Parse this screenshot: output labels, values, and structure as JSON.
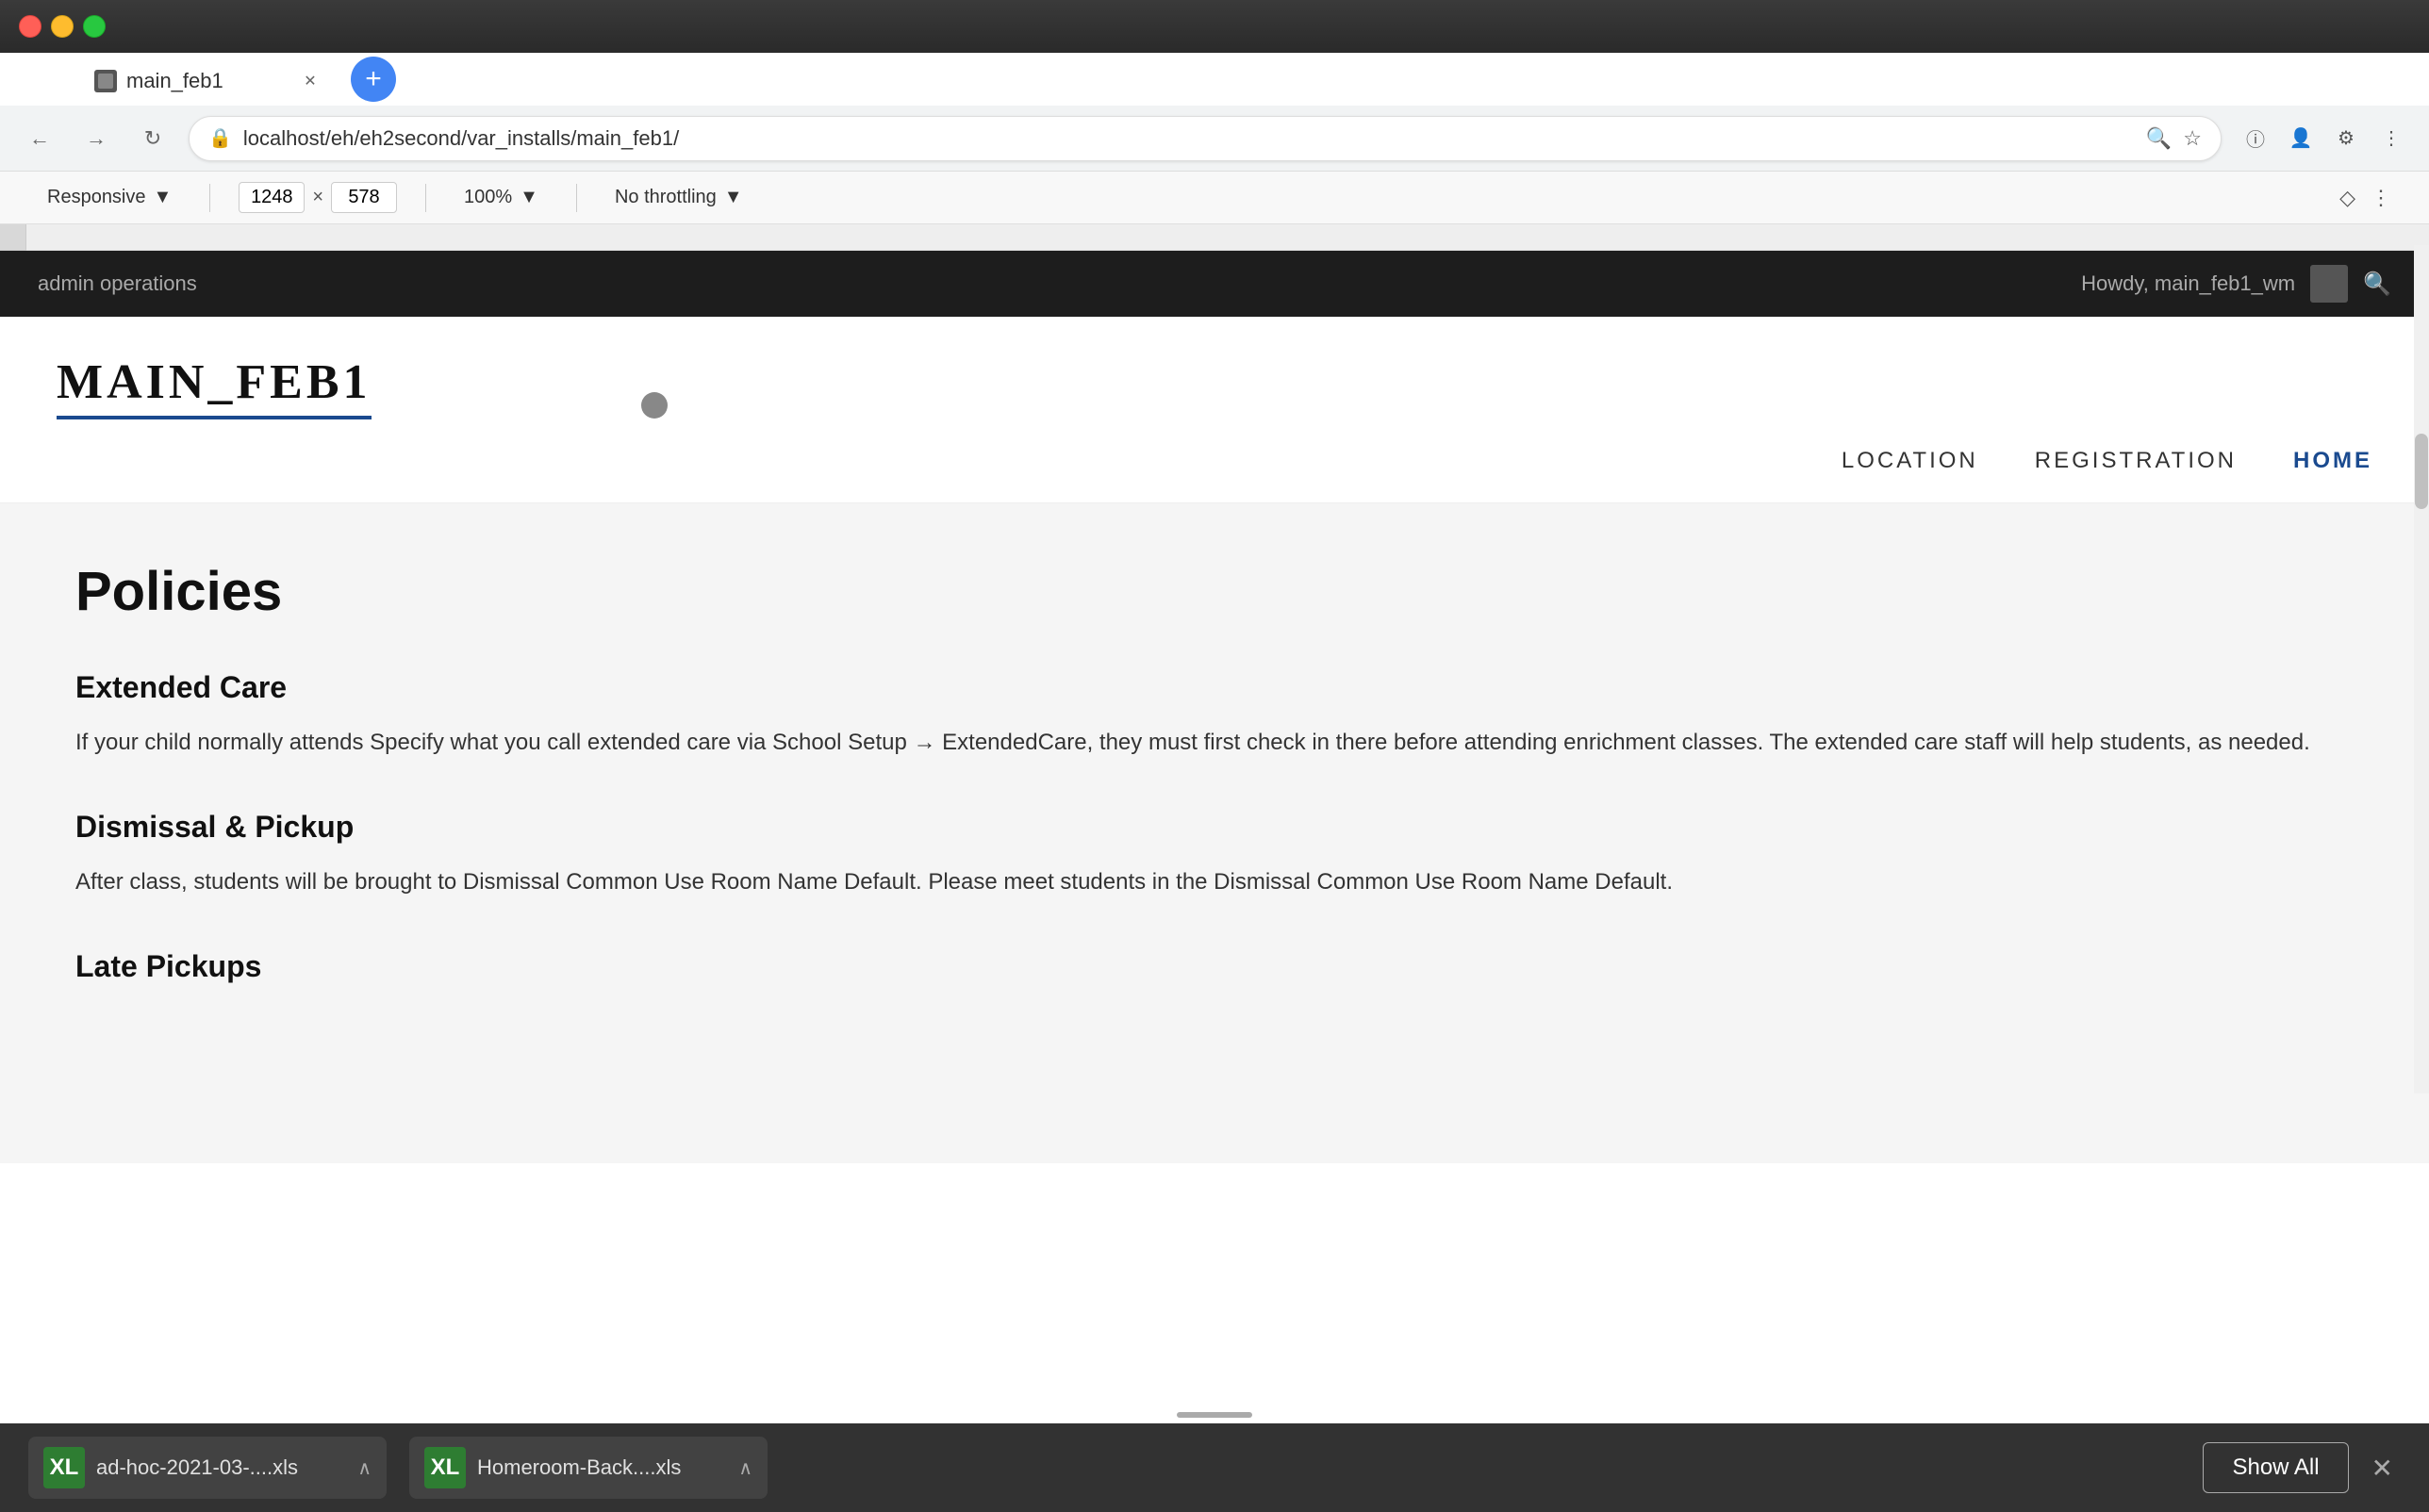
{
  "browser": {
    "traffic_lights": [
      "red",
      "yellow",
      "green"
    ],
    "tab": {
      "title": "main_feb1",
      "favicon_color": "#555"
    },
    "new_tab_label": "+",
    "address": {
      "url": "localhost/eh/eh2second/var_installs/main_feb1/",
      "lock_icon": "🔒"
    },
    "nav": {
      "back": "←",
      "forward": "→",
      "refresh": "↻"
    }
  },
  "devtools": {
    "viewport_mode": "Responsive",
    "width": "1248",
    "height": "578",
    "zoom": "100%",
    "throttling": "No throttling",
    "diamond_icon": "◇"
  },
  "admin_bar": {
    "title": "admin operations",
    "howdy": "Howdy, main_feb1_wm"
  },
  "site": {
    "logo": "MAIN_FEB1",
    "nav_items": [
      {
        "label": "LOCATION",
        "active": false
      },
      {
        "label": "REGISTRATION",
        "active": false
      },
      {
        "label": "HOME",
        "active": true
      }
    ]
  },
  "page": {
    "title": "Policies",
    "sections": [
      {
        "heading": "Extended Care",
        "text": "If your child normally attends Specify what you call extended care via School Setup → ExtendedCare, they must first check in there before attending enrichment classes. The extended care staff will help students, as needed."
      },
      {
        "heading": "Dismissal & Pickup",
        "text": "After class, students will be brought to Dismissal Common Use Room Name Default. Please meet students in the Dismissal Common Use Room Name Default."
      },
      {
        "heading": "Late Pickups",
        "text": ""
      }
    ]
  },
  "downloads": [
    {
      "name": "ad-hoc-2021-03-....xls",
      "icon_label": "XL"
    },
    {
      "name": "Homeroom-Back....xls",
      "icon_label": "XL"
    }
  ],
  "bottom_bar": {
    "show_all_label": "Show All",
    "close_label": "✕"
  }
}
